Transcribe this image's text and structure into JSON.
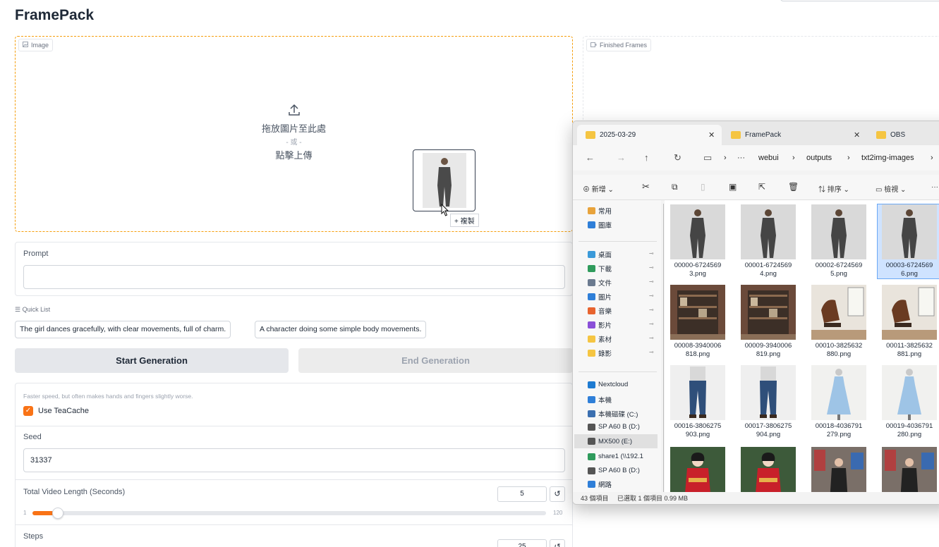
{
  "app": {
    "title": "FramePack"
  },
  "image_panel": {
    "label": "Image",
    "drop_text": "拖放圖片至此處",
    "or_text": "- 或 -",
    "click_text": "點擊上傳",
    "copy_badge": "+ 複製"
  },
  "frames_panel": {
    "label": "Finished Frames"
  },
  "prompt": {
    "label": "Prompt",
    "value": ""
  },
  "quick_list": {
    "label": "Quick List",
    "items": [
      "The girl dances gracefully, with clear movements, full of charm.",
      "A character doing some simple body movements."
    ]
  },
  "actions": {
    "start": "Start Generation",
    "end": "End Generation"
  },
  "settings": {
    "hint": "Faster speed, but often makes hands and fingers slightly worse.",
    "teacache_label": "Use TeaCache",
    "teacache_checked": true,
    "seed_label": "Seed",
    "seed_value": "31337",
    "length_label": "Total Video Length (Seconds)",
    "length_value": "5",
    "length_min": "1",
    "length_max": "120",
    "steps_label": "Steps",
    "steps_value": "25",
    "reset_glyph": "↺"
  },
  "explorer": {
    "tabs": [
      {
        "label": "2025-03-29",
        "close": "✕"
      },
      {
        "label": "FramePack",
        "close": "✕"
      },
      {
        "label": "OBS",
        "close": ""
      }
    ],
    "breadcrumb": [
      "···",
      "webui",
      "outputs",
      "txt2img-images"
    ],
    "commands": {
      "new": "新增",
      "sort": "排序",
      "view": "檢視",
      "more": "···"
    },
    "nav": [
      {
        "label": "常用",
        "color": "#e8a33b"
      },
      {
        "label": "圖庫",
        "color": "#2f7fd8"
      },
      {
        "label": "桌面",
        "color": "#3b9ad9",
        "pin": "📌"
      },
      {
        "label": "下載",
        "color": "#2f9b5c",
        "pin": "📌"
      },
      {
        "label": "文件",
        "color": "#6b7a8f",
        "pin": "📌"
      },
      {
        "label": "圖片",
        "color": "#2f7fd8",
        "pin": "📌"
      },
      {
        "label": "音樂",
        "color": "#e8642f",
        "pin": "📌"
      },
      {
        "label": "影片",
        "color": "#8a4fd8",
        "pin": "📌"
      },
      {
        "label": "素材",
        "color": "#f5c542",
        "pin": "📌"
      },
      {
        "label": "錄影",
        "color": "#f5c542",
        "pin": "📌"
      },
      {
        "label": "Nextcloud",
        "color": "#1e7bd1"
      },
      {
        "label": "本機",
        "color": "#2f7fd8"
      },
      {
        "label": "本機磁碟 (C:)",
        "color": "#3b6fb0"
      },
      {
        "label": "SP A60 B (D:)",
        "color": "#555555"
      },
      {
        "label": "MX500 (E:)",
        "color": "#555555"
      },
      {
        "label": "share1 (\\\\192.1",
        "color": "#2f9b5c"
      },
      {
        "label": "SP A60 B (D:)",
        "color": "#555555"
      },
      {
        "label": "網路",
        "color": "#2f7fd8"
      }
    ],
    "files": [
      {
        "name": "00000-6724569 3.png",
        "kind": "suit"
      },
      {
        "name": "00001-6724569 4.png",
        "kind": "suit"
      },
      {
        "name": "00002-6724569 5.png",
        "kind": "suit"
      },
      {
        "name": "00003-6724569 6.png",
        "kind": "suit",
        "selected": true
      },
      {
        "name": "00008-3940006 818.png",
        "kind": "shelf"
      },
      {
        "name": "00009-3940006 819.png",
        "kind": "shelf"
      },
      {
        "name": "00010-3825632 880.png",
        "kind": "chair"
      },
      {
        "name": "00011-3825632 881.png",
        "kind": "chair"
      },
      {
        "name": "00016-3806275 903.png",
        "kind": "jeans"
      },
      {
        "name": "00017-3806275 904.png",
        "kind": "jeans"
      },
      {
        "name": "00018-4036791 279.png",
        "kind": "dress"
      },
      {
        "name": "00019-4036791 280.png",
        "kind": "dress"
      },
      {
        "name": "",
        "kind": "kimono"
      },
      {
        "name": "",
        "kind": "kimono"
      },
      {
        "name": "",
        "kind": "street"
      },
      {
        "name": "",
        "kind": "street"
      }
    ],
    "status": {
      "count": "43 個項目",
      "selected": "已選取 1 個項目 0.99 MB"
    }
  }
}
